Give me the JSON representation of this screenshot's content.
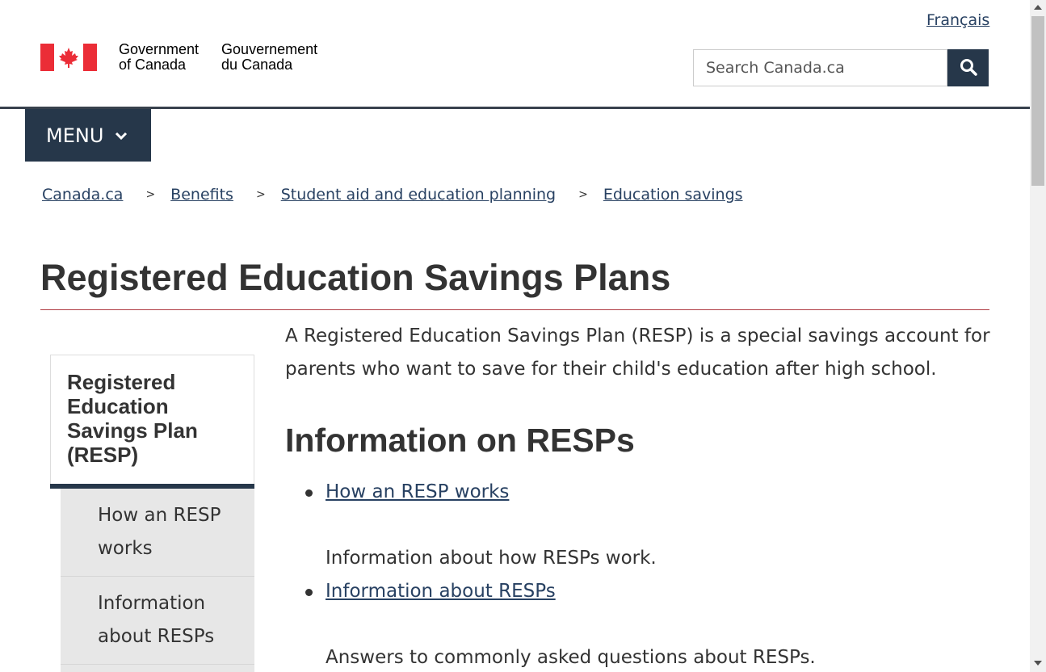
{
  "header": {
    "language_link": "Français",
    "signature": {
      "en_line1": "Government",
      "en_line2": "of Canada",
      "fr_line1": "Gouvernement",
      "fr_line2": "du Canada"
    },
    "search": {
      "placeholder": "Search Canada.ca",
      "button_icon": "search-icon"
    },
    "menu_label": "MENU"
  },
  "breadcrumb": [
    "Canada.ca",
    "Benefits",
    "Student aid and education planning",
    "Education savings"
  ],
  "breadcrumb_separator": ">",
  "page": {
    "title": "Registered Education Savings Plans"
  },
  "sidenav": {
    "heading": "Registered Education Savings Plan (RESP)",
    "items": [
      "How an RESP works",
      "Information about RESPs"
    ]
  },
  "main": {
    "intro": "A Registered Education Savings Plan (RESP) is a special savings account for parents who want to save for their child's education after high school.",
    "section_heading": "Information on RESPs",
    "links": [
      {
        "title": "How an RESP works",
        "description": "Information about how RESPs work."
      },
      {
        "title": "Information about RESPs",
        "description": "Answers to commonly asked questions about RESPs."
      }
    ]
  },
  "colors": {
    "brand_navy": "#26374a",
    "link": "#284162",
    "flag_red": "#eb2d37",
    "title_rule": "#af3c43"
  }
}
